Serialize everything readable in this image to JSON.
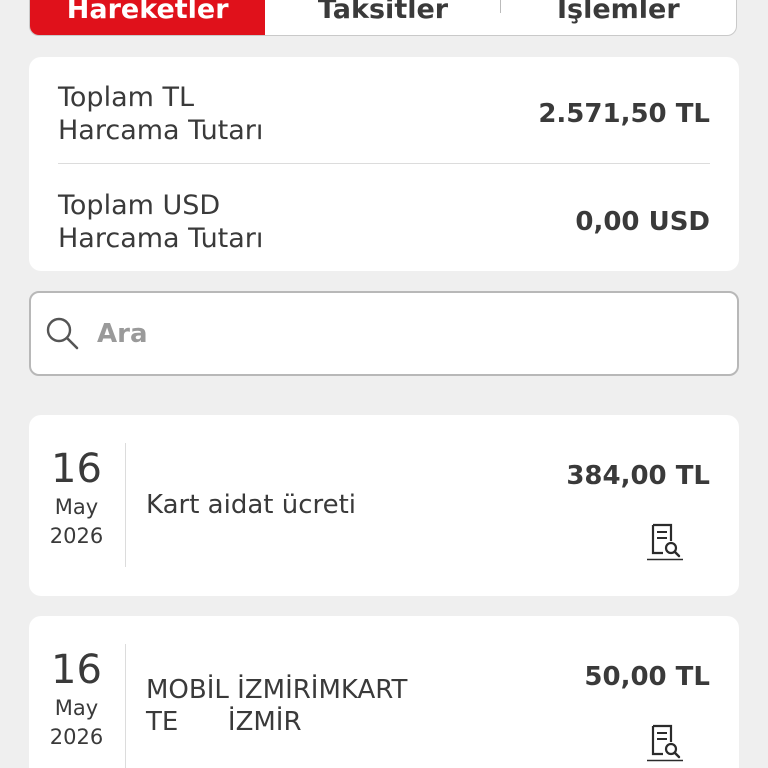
{
  "tabs": [
    {
      "label": "Hareketler",
      "active": true
    },
    {
      "label": "Taksitler",
      "active": false
    },
    {
      "label": "İşlemler",
      "active": false
    }
  ],
  "summary": {
    "tl": {
      "label_line1": "Toplam TL",
      "label_line2": "Harcama Tutarı",
      "value": "2.571,50 TL"
    },
    "usd": {
      "label_line1": "Toplam USD",
      "label_line2": "Harcama Tutarı",
      "value": "0,00 USD"
    }
  },
  "search": {
    "placeholder": "Ara",
    "value": "",
    "icon": "search-icon"
  },
  "transactions": [
    {
      "day": "16",
      "month": "May",
      "year": "2026",
      "description": "Kart aidat ücreti",
      "amount": "384,00 TL",
      "icon": "receipt-search-icon"
    },
    {
      "day": "16",
      "month": "May",
      "year": "2026",
      "description": "MOBİL İZMİRİMKART\nTE      İZMİR",
      "amount": "50,00 TL",
      "icon": "receipt-search-icon"
    }
  ],
  "colors": {
    "accent": "#e0111b",
    "background": "#efefef",
    "card": "#ffffff",
    "text": "#3a3a3a"
  }
}
